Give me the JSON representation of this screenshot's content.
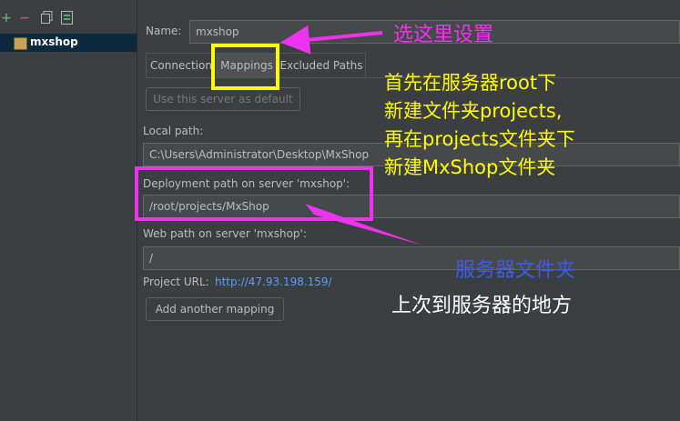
{
  "left": {
    "toolbar": {
      "add": "+",
      "remove": "−"
    },
    "server_item": "mxshop"
  },
  "form": {
    "name_label": "Name:",
    "name_value": "mxshop",
    "tabs": [
      {
        "label": "Connection"
      },
      {
        "label": "Mappings"
      },
      {
        "label": "Excluded Paths"
      }
    ],
    "use_default_button": "Use this server as default",
    "local_path_label": "Local path:",
    "local_path_value": "C:\\Users\\Administrator\\Desktop\\MxShop",
    "deploy_path_label": "Deployment path on server 'mxshop':",
    "deploy_path_value": "/root/projects/MxShop",
    "web_path_label": "Web path on server 'mxshop':",
    "web_path_value": "/",
    "project_url_label": "Project URL:",
    "project_url_value": "http://47.93.198.159/",
    "add_mapping_button": "Add another mapping"
  },
  "annotations": {
    "set_here": "选这里设置",
    "instruction_lines": [
      "首先在服务器root下",
      "新建文件夹projects,",
      "再在projects文件夹下",
      "新建MxShop文件夹"
    ],
    "server_folder": "服务器文件夹",
    "upload_location": "上次到服务器的地方"
  },
  "colors": {
    "highlight_yellow": "#ffff00",
    "highlight_magenta": "#ee33ee",
    "annotation_text_yellow": "#ffff00",
    "annotation_text_blue": "#3d5ce8",
    "annotation_text_white": "#ffffff"
  }
}
